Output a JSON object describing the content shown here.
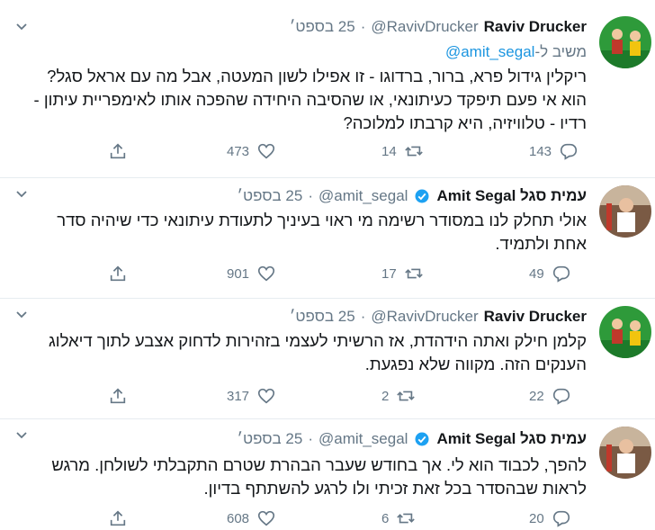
{
  "colors": {
    "name": "#14171a",
    "meta": "#657786",
    "link": "#1b95e0",
    "verified": "#1da1f2",
    "border": "#e6ecf0"
  },
  "tweets": [
    {
      "name": "Raviv Drucker",
      "handle": "@RavivDrucker",
      "dot": "·",
      "time": "25 בספט׳",
      "verified": false,
      "reply_prefix": "משיב ל-",
      "reply_mention": "@amit_segal",
      "text": "ריקלין גידול פרא, ברור, ברדוגו - זו אפילו לשון המעטה, אבל מה עם אראל סגל? הוא אי פעם תיפקד כעיתונאי, או שהסיבה היחידה שהפכה אותו לאימפריית עיתון - רדיו - טלוויזיה, היא קרבתו למלוכה?",
      "replies": "143",
      "retweets": "14",
      "likes": "473"
    },
    {
      "name": "עמית סגל Amit Segal",
      "handle": "@amit_segal",
      "dot": "·",
      "time": "25 בספט׳",
      "verified": true,
      "text": "אולי תחלק לנו במסודר רשימה מי ראוי בעיניך לתעודת עיתונאי כדי שיהיה סדר אחת ולתמיד.",
      "replies": "49",
      "retweets": "17",
      "likes": "901"
    },
    {
      "name": "Raviv Drucker",
      "handle": "@RavivDrucker",
      "dot": "·",
      "time": "25 בספט׳",
      "verified": false,
      "text": "קלמן חילק ואתה הידהדת, אז הרשיתי לעצמי בזהירות לדחוק אצבע לתוך דיאלוג הענקים הזה. מקווה שלא נפגעת.",
      "replies": "22",
      "retweets": "2",
      "likes": "317"
    },
    {
      "name": "עמית סגל Amit Segal",
      "handle": "@amit_segal",
      "dot": "·",
      "time": "25 בספט׳",
      "verified": true,
      "text": "להפך, לכבוד הוא לי. אך בחודש שעבר הבהרת שטרם התקבלתי לשולחן. מרגש לראות שבהסדר בכל זאת זכיתי ולו לרגע להשתתף בדיון.",
      "replies": "20",
      "retweets": "6",
      "likes": "608"
    }
  ]
}
